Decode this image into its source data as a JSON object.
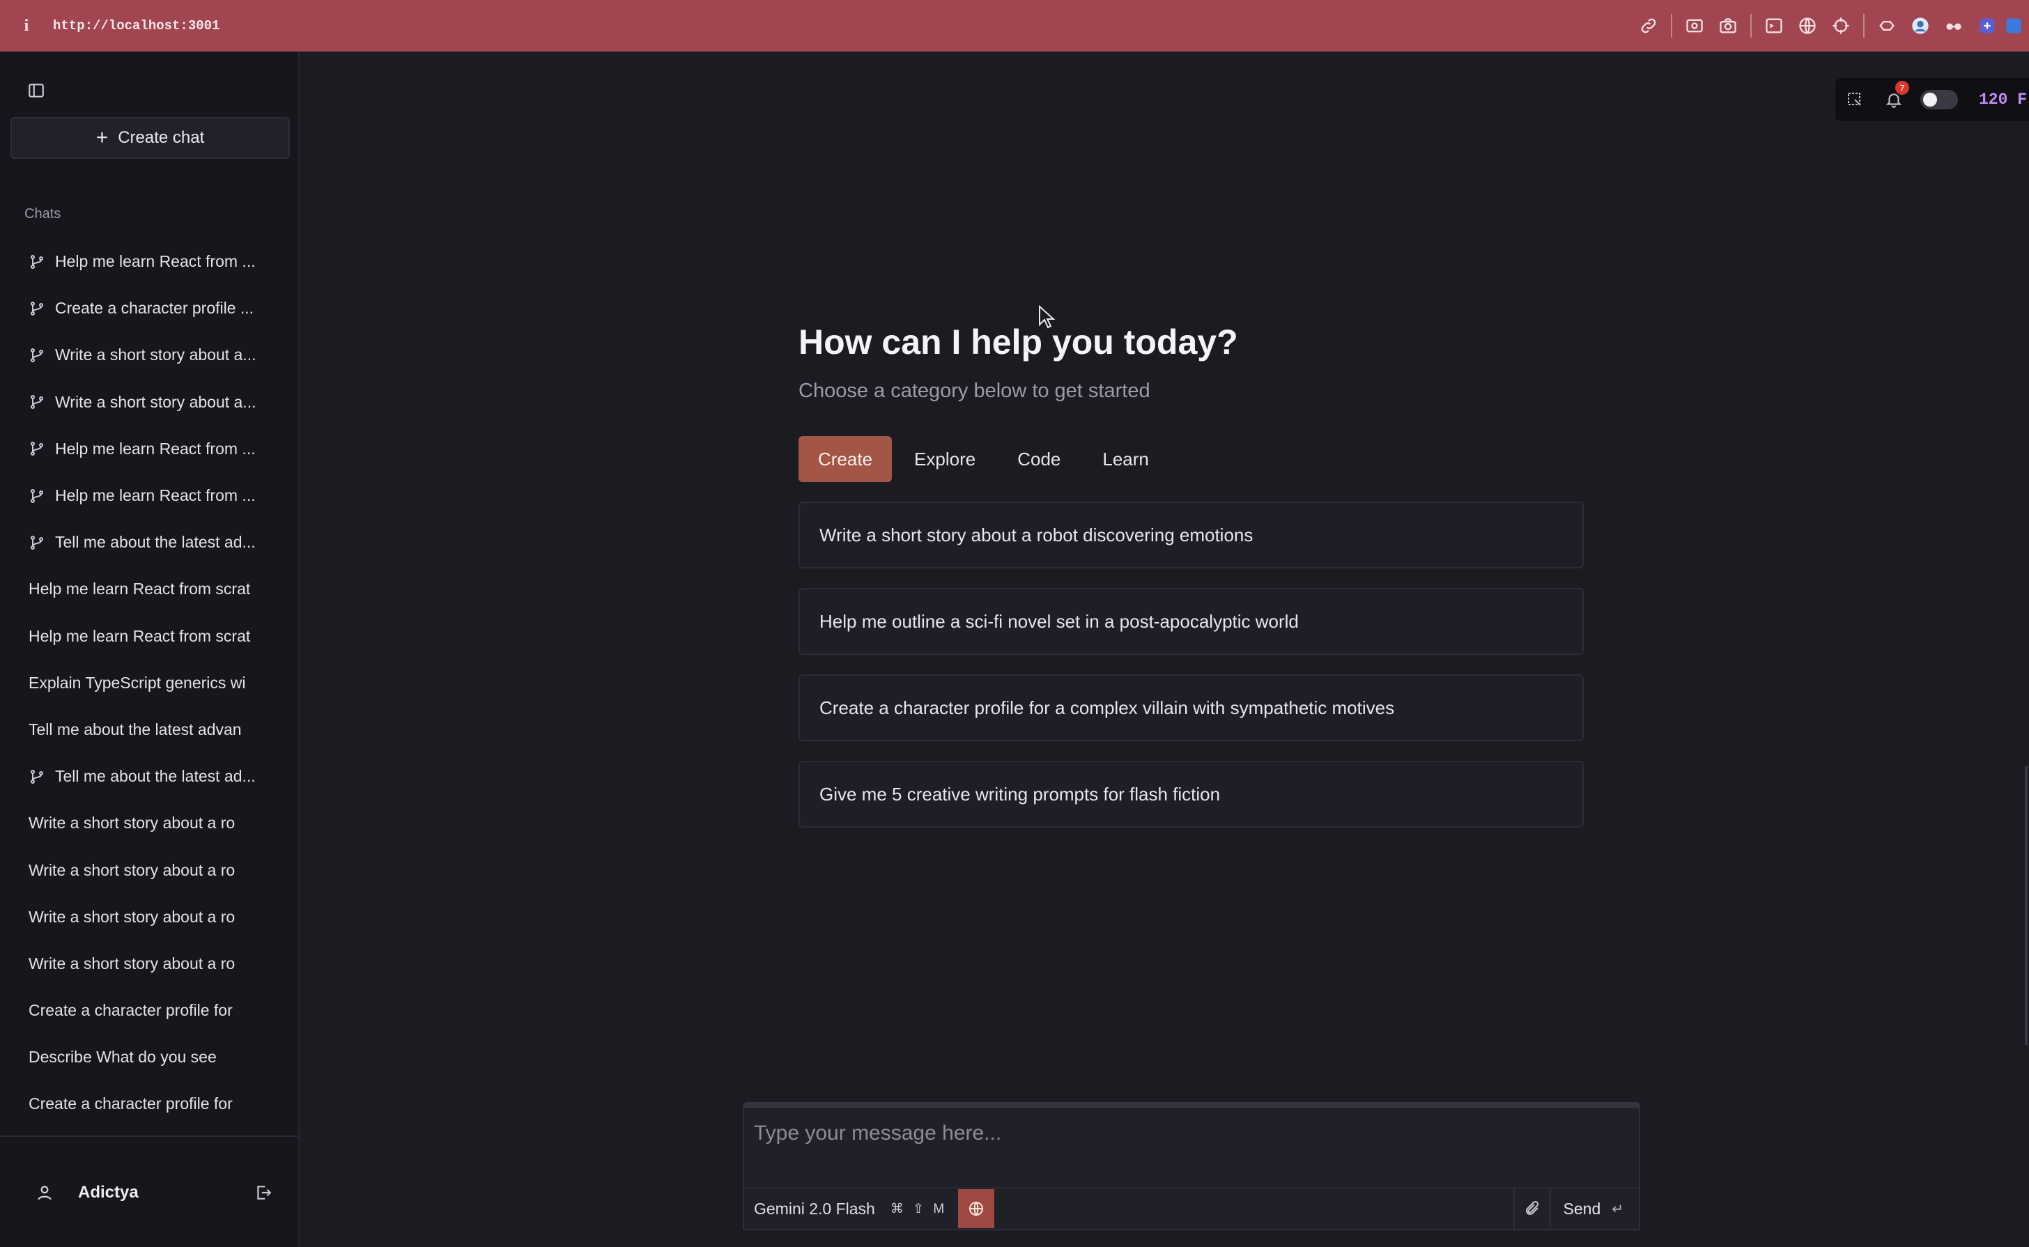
{
  "browser": {
    "info_glyph": "i",
    "url": "http://localhost:3001",
    "tool_icons": [
      "link-icon",
      "screen-record-icon",
      "camera-icon",
      "terminal-icon",
      "globe-icon",
      "crosshair-icon",
      "extension-icon",
      "avatar-icon",
      "glasses-icon",
      "app-icon",
      "extension-blue-icon"
    ],
    "bar_color": "#a14550"
  },
  "sidebar": {
    "create_label": "Create chat",
    "section_label": "Chats",
    "items": [
      {
        "label": "Help me learn React from ...",
        "branch": true
      },
      {
        "label": "Create a character profile ...",
        "branch": true
      },
      {
        "label": "Write a short story about a...",
        "branch": true
      },
      {
        "label": "Write a short story about a...",
        "branch": true
      },
      {
        "label": "Help me learn React from ...",
        "branch": true
      },
      {
        "label": "Help me learn React from ...",
        "branch": true
      },
      {
        "label": "Tell me about the latest ad...",
        "branch": true
      },
      {
        "label": "Help me learn React from scrat",
        "branch": false
      },
      {
        "label": "Help me learn React from scrat",
        "branch": false
      },
      {
        "label": "Explain TypeScript generics wi",
        "branch": false
      },
      {
        "label": "Tell me about the latest advan",
        "branch": false
      },
      {
        "label": "Tell me about the latest ad...",
        "branch": true
      },
      {
        "label": "Write a short story about a ro",
        "branch": false
      },
      {
        "label": "Write a short story about a ro",
        "branch": false
      },
      {
        "label": "Write a short story about a ro",
        "branch": false
      },
      {
        "label": "Write a short story about a ro",
        "branch": false
      },
      {
        "label": "Create a character profile for",
        "branch": false
      },
      {
        "label": "Describe What do you see",
        "branch": false
      },
      {
        "label": "Create a character profile for",
        "branch": false
      }
    ],
    "user": {
      "name": "Adictya"
    }
  },
  "float_toolbar": {
    "notification_count": "7",
    "toggle_on": false,
    "fps": "120 F"
  },
  "main": {
    "heading": "How can I help you today?",
    "subheading": "Choose a category below to get started",
    "tabs": [
      {
        "label": "Create",
        "active": true
      },
      {
        "label": "Explore",
        "active": false
      },
      {
        "label": "Code",
        "active": false
      },
      {
        "label": "Learn",
        "active": false
      }
    ],
    "suggestions": [
      "Write a short story about a robot discovering emotions",
      "Help me outline a sci-fi novel set in a post-apocalyptic world",
      "Create a character profile for a complex villain with sympathetic motives",
      "Give me 5 creative writing prompts for flash fiction"
    ],
    "accent_color": "#a35546"
  },
  "composer": {
    "placeholder": "Type your message here...",
    "value": "",
    "model": "Gemini 2.0 Flash",
    "model_shortcut": "⌘ ⇧ M",
    "send_label": "Send",
    "send_hint": "↵"
  }
}
